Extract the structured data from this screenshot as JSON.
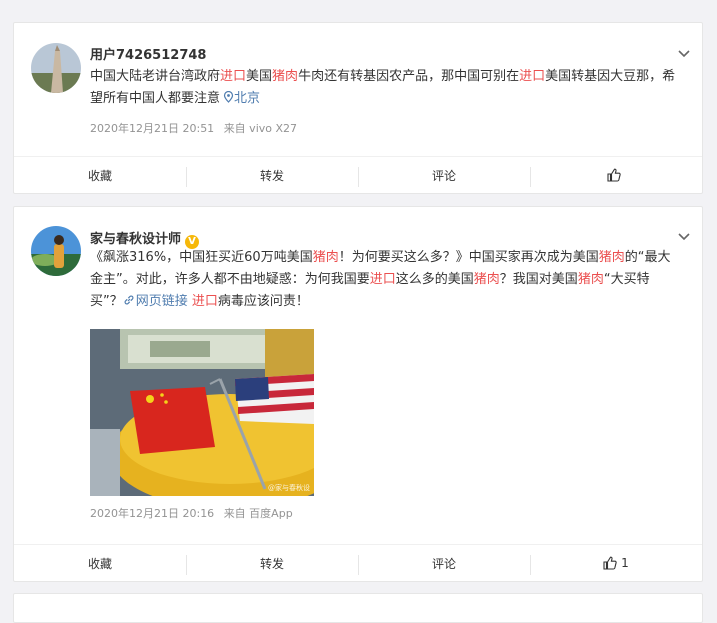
{
  "posts": [
    {
      "username": "用户7426512748",
      "verified": false,
      "text_parts": [
        {
          "t": "中国大陆老讲台湾政府",
          "hl": false
        },
        {
          "t": "进口",
          "hl": true
        },
        {
          "t": "美国",
          "hl": false
        },
        {
          "t": "猪肉",
          "hl": true
        },
        {
          "t": "牛肉还有转基因农产品，那中国可别在",
          "hl": false
        },
        {
          "t": "进口",
          "hl": true
        },
        {
          "t": "美国转基因大豆那，希望所有中国人都要注意",
          "hl": false
        }
      ],
      "location": "北京",
      "timestamp": "2020年12月21日 20:51",
      "source": "来自 vivo X27",
      "actions": {
        "favorite": "收藏",
        "repost": "转发",
        "comment": "评论",
        "like_count": ""
      }
    },
    {
      "username": "家与春秋设计师",
      "verified": true,
      "text_parts": [
        {
          "t": "《飙涨316%，中国狂买近60万吨美国",
          "hl": false
        },
        {
          "t": "猪肉",
          "hl": true
        },
        {
          "t": "！为何要买这么多？》中国买家再次成为美国",
          "hl": false
        },
        {
          "t": "猪肉",
          "hl": true
        },
        {
          "t": "的“最大金主”。对此，许多人都不由地疑惑：为何我国要",
          "hl": false
        },
        {
          "t": "进口",
          "hl": true
        },
        {
          "t": "这么多的美国",
          "hl": false
        },
        {
          "t": "猪肉",
          "hl": true
        },
        {
          "t": "？我国对美国",
          "hl": false
        },
        {
          "t": "猪肉",
          "hl": true
        },
        {
          "t": "“大买特买”？",
          "hl": false
        }
      ],
      "link_label": "网页链接",
      "tail_hl": "进口",
      "tail_text": "病毒应该问责！",
      "image_watermark": "@家与春秋设",
      "timestamp": "2020年12月21日 20:16",
      "source": "来自 百度App",
      "actions": {
        "favorite": "收藏",
        "repost": "转发",
        "comment": "评论",
        "like_count": "1"
      }
    }
  ],
  "colors": {
    "highlight": "#eb5050",
    "link": "#507daf",
    "meta": "#939393",
    "verified": "#f6b80a"
  },
  "icons": [
    "chevron-down-icon",
    "location-pin-icon",
    "link-icon",
    "thumbs-up-icon",
    "verified-badge-icon"
  ]
}
